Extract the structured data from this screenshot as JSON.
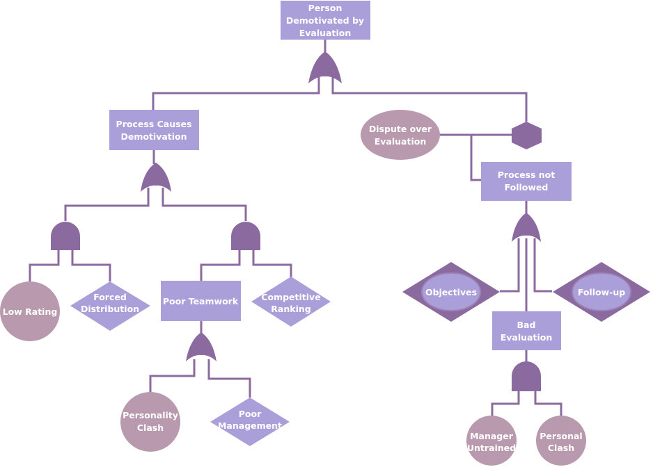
{
  "diagram": {
    "title": "Person Demotivated by Evaluation",
    "colors": {
      "rect": "#ab9fd9",
      "event_circle": "#b899ad",
      "diamond": "#ab9fd9",
      "gate": "#8b6b9f",
      "line": "#8b6b9f",
      "label": "#ffffff"
    },
    "nodes": {
      "top": {
        "kind": "rectangle",
        "lines": [
          "Person",
          "Demotivated by",
          "Evaluation"
        ]
      },
      "process_causes": {
        "kind": "rectangle",
        "lines": [
          "Process Causes",
          "Demotivation"
        ]
      },
      "dispute": {
        "kind": "ellipse",
        "lines": [
          "Dispute over",
          "Evaluation"
        ]
      },
      "process_not_followed": {
        "kind": "rectangle",
        "lines": [
          "Process not",
          "Followed"
        ]
      },
      "low_rating": {
        "kind": "circle",
        "lines": [
          "Low Rating"
        ]
      },
      "forced_distribution": {
        "kind": "diamond",
        "lines": [
          "Forced",
          "Distribution"
        ]
      },
      "poor_teamwork": {
        "kind": "rectangle",
        "lines": [
          "Poor Teamwork"
        ]
      },
      "competitive_ranking": {
        "kind": "diamond",
        "lines": [
          "Competitive",
          "Ranking"
        ]
      },
      "personality_clash": {
        "kind": "circle",
        "lines": [
          "Personality",
          "Clash"
        ]
      },
      "poor_management": {
        "kind": "diamond",
        "lines": [
          "Poor",
          "Management"
        ]
      },
      "objectives": {
        "kind": "house-diamond",
        "lines": [
          "Objectives"
        ]
      },
      "follow_up": {
        "kind": "house-diamond",
        "lines": [
          "Follow-up"
        ]
      },
      "bad_evaluation": {
        "kind": "rectangle",
        "lines": [
          "Bad",
          "Evaluation"
        ]
      },
      "manager_untrained": {
        "kind": "circle",
        "lines": [
          "Manager",
          "Untrained"
        ]
      },
      "personal_clash": {
        "kind": "circle",
        "lines": [
          "Personal",
          "Clash"
        ]
      }
    },
    "gates": {
      "or_top": "OR",
      "or_process_causes": "OR",
      "and_low_rating": "AND",
      "and_poor_teamwork": "AND",
      "or_poor_teamwork": "OR",
      "inhibit_dispute": "INHIBIT",
      "or_process_not_followed": "OR",
      "and_bad_evaluation": "AND"
    }
  }
}
